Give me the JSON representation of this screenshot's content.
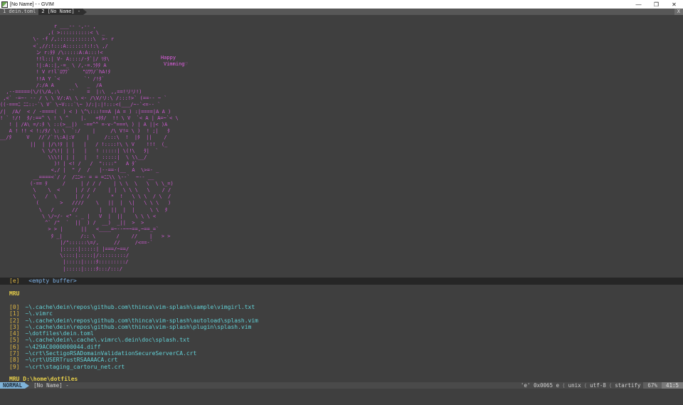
{
  "window": {
    "title": "[No Name] - - GVIM",
    "minimize": "—",
    "maximize": "❐",
    "close": "✕"
  },
  "tabline": {
    "tabs": [
      {
        "label": "1 dein.toml"
      },
      {
        "label": "2 [No Name] -"
      }
    ],
    "close": "X"
  },
  "splash": {
    "art": "                  r ___-- -,-- ,\n                ,( >::::::::::< \\ _\n           \\- -f /,:::::;::::::\\  >- r\n           <`,//:!:::A::::::!:!:\\ ,/\n            ン r:ﾀﾀ /\\:::::A:A:::!<\n            !!l::| V- A::::/-ﾀ`|/ ﾘﾀ\\\n            !|:A::|,-=_ \\ /,-=.ﾗﾀﾀ A\n            ! V r!l`ﾛﾜﾜ`    \"ﾛﾜﾜ/`hA!ﾀ\n            !!A Y `<        `' /!ﾀ`\n            /:/A A       \\   _  /A\n  ,--=====(\\/(\\/A,:\\   ``    =  |:\\  ,,==!リリ!)\n ,<` -=~- -- / \\ \\ V/:A\\ \\ <- /\\V/リ:\\ /:::!>` (==-- ~ `\n((-===ﾆ ﾆﾆ::-`\\ V` \\~V:::`\\~ )/:|:|!:::<(___/~-`<=-- `\n/|  /A/  < / -====(  ) < ) \\^\\:::!==A |A = ) :|====|A A )\n! ` !/!  ﾀ/:==^ \\ ! \\ ^    |.   +ﾀﾀ/  !! \\ V  `< A | A=~`< \\\n   ! | /A\\ =/:ﾀ \\ ::(>__|)  -==^^ =-v-^===\\ ) | A ||< )A\n   A ! !! < !:/ﾀ/ \\: \\  `:/    |     /\\ V!= \\ )  ! ;|   ﾀ\n__/ﾀ     V   //`/`!\\:A|:V    |     /:::\\  !  |ﾀ  ||    /\n          ||  | |/\\!ﾀ | |   |   / !::::!\\ \\ V    !!!  (_\n              \\ \\/\\!| | |   |   ! :::::| \\(!\\   ﾀ|  `\n                \\\\\\!| | |   |   ! :::::|  \\ \\\\__/\n                  )! | <! /   /  \"::::\"   A ﾀ`\n                 <,/ |  \" /  /   |--==-(__  A  \\>=- _\n           __====<`/ /  /ﾆﾆ=- = = =ﾆﾆ\\\\ \\--`  ~-- __\n          (-== ﾀ     /     | / / /    | \\ \\  \\   \\  \\ \\_=)\n           \\    \\  <     | / / /    | |  \\ \\ \\   \\    / /\n           \\   /  \\      | / /       *  !   \\ \\ \\  / \\  /\n            (       >   ////    \\   ||  |  \\|   \\ \\ \\   )\n             \\   /      //       |   ||  |  |     \\ \\  ﾀ\n              \\ \\/~/- <\" - _ |   V  |  ||    \\ \\ \\ <\n               ^` /\"  `  ||  ) /  __)  _||  >  >\n                > > |      ||   <____=~--~~~==,~==_=`\n                 ﾀ _|      /:: \\       /    //    |   > >\n                    |/\"::::::\\=/,     //     /<==-`\n                    |:::::|:::::| |===/~==/\n                    \\::::|:::::|/:::::::::/\n                     |:::::|::::ﾀ:::::::::/\n                     |:::::|::::ﾀ:::/:::/",
    "happy": "Happy",
    "vimming": "Vimming♡"
  },
  "empty_buffer": {
    "key": "[e]",
    "label": "<empty buffer>"
  },
  "mru": {
    "title": "MRU",
    "items": [
      {
        "idx": "[0]",
        "path": "~\\.cache\\dein\\repos\\github.com\\thinca\\vim-splash\\sample\\vimgirl.txt"
      },
      {
        "idx": "[1]",
        "path": "~\\.vimrc"
      },
      {
        "idx": "[2]",
        "path": "~\\.cache\\dein\\repos\\github.com\\thinca\\vim-splash\\autoload\\splash.vim"
      },
      {
        "idx": "[3]",
        "path": "~\\.cache\\dein\\repos\\github.com\\thinca\\vim-splash\\plugin\\splash.vim"
      },
      {
        "idx": "[4]",
        "path": "~\\dotfiles\\dein.toml"
      },
      {
        "idx": "[5]",
        "path": "~\\.cache\\dein\\.cache\\.vimrc\\.dein\\doc\\splash.txt"
      },
      {
        "idx": "[6]",
        "path": "~\\429AC0000000044.diff"
      },
      {
        "idx": "[7]",
        "path": "~\\crt\\SectigoRSADomainValidationSecureServerCA.crt"
      },
      {
        "idx": "[8]",
        "path": "~\\crt\\USERTrustRSAAAACA.crt"
      },
      {
        "idx": "[9]",
        "path": "~\\crt\\staging_cartoru_net.crt"
      }
    ],
    "dir_title": "MRU D:\\home\\dotfiles"
  },
  "statusline": {
    "mode": "NORMAL",
    "filename": "[No Name] -",
    "char_info": "'e' 0x0065 e",
    "fileformat": "unix",
    "encoding": "utf-8",
    "filetype": "startify",
    "percent": "67%",
    "position": "41:5"
  }
}
